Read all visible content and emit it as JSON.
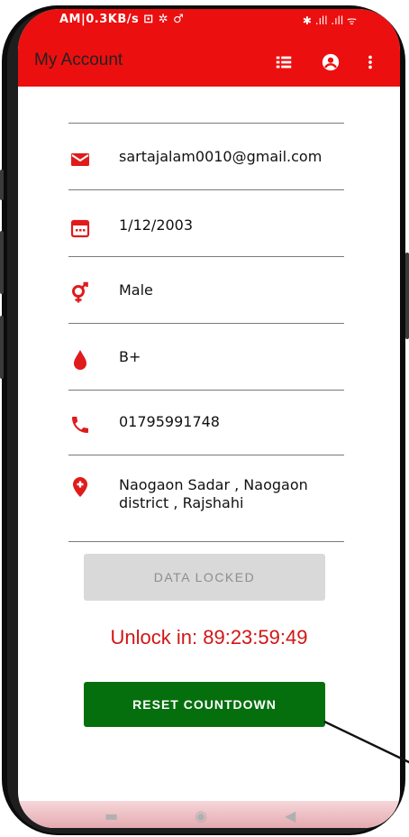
{
  "status_bar": {
    "left": "AM|0.3KB/s ⊡ ✲ ♂",
    "right": "✱ .ıll .ıll ᯤ"
  },
  "appbar": {
    "title": "My Account",
    "icons": [
      "list-icon",
      "account-circle-icon",
      "more-vert-icon"
    ]
  },
  "profile": [
    {
      "icon": "email-icon",
      "value": "sartajalam0010@gmail.com"
    },
    {
      "icon": "calendar-icon",
      "value": "1/12/2003"
    },
    {
      "icon": "gender-icon",
      "value": "Male"
    },
    {
      "icon": "blood-drop-icon",
      "value": "B+"
    },
    {
      "icon": "phone-icon",
      "value": "01795991748"
    },
    {
      "icon": "location-pin-icon",
      "value": "Naogaon Sadar , Naogaon district , Rajshahi"
    }
  ],
  "data_locked_label": "DATA LOCKED",
  "unlock_text": "Unlock in: 89:23:59:49",
  "reset_label": "RESET COUNTDOWN",
  "colors": {
    "appbar": "#ec0f0f",
    "icon_red": "#e01b1b",
    "reset_green": "#056f0e",
    "unlock_red": "#d11515"
  }
}
